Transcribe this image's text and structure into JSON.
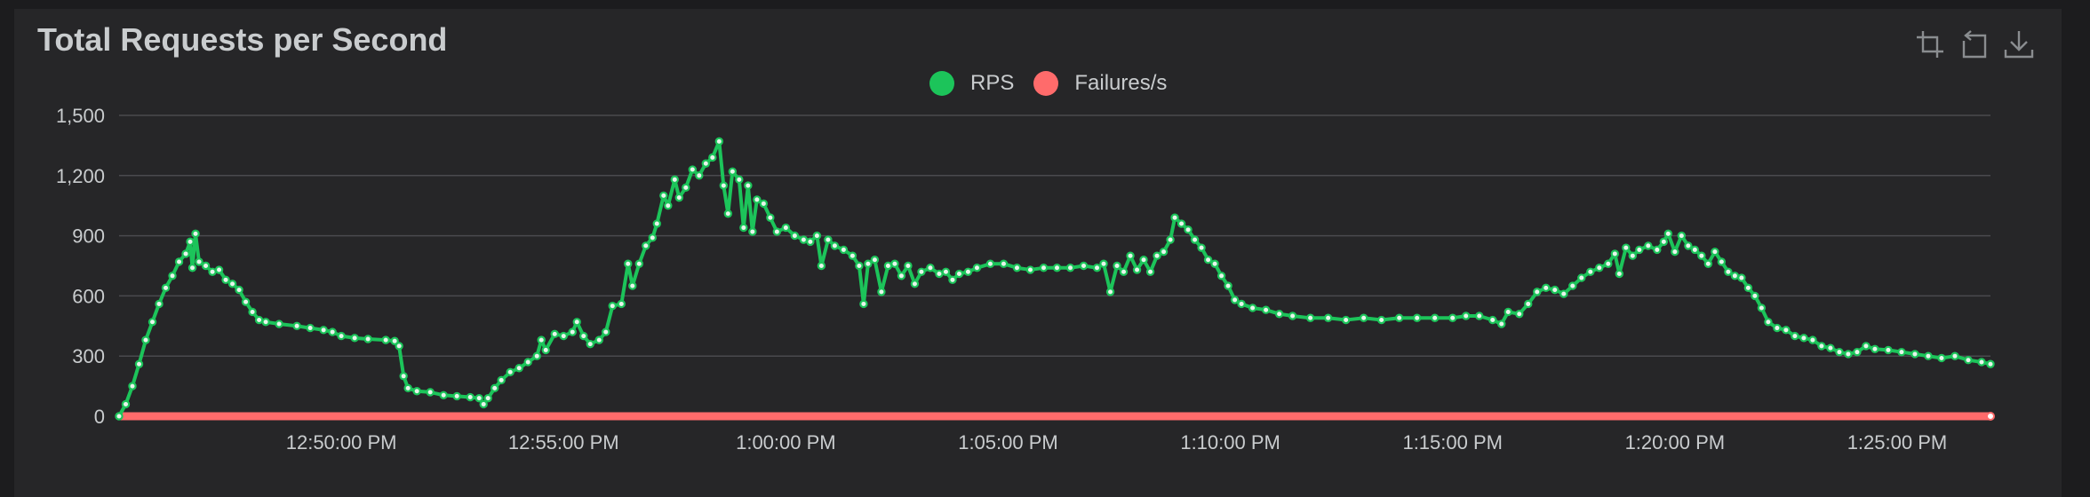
{
  "chart_data": {
    "type": "line",
    "title": "Total Requests per Second",
    "xlabel": "",
    "ylabel": "",
    "ylim": [
      0,
      1500
    ],
    "y_ticks": [
      "0",
      "300",
      "600",
      "900",
      "1,200",
      "1,500"
    ],
    "y_tick_values": [
      0,
      300,
      600,
      900,
      1200,
      1500
    ],
    "x_ticks": [
      "12:50:00 PM",
      "12:55:00 PM",
      "1:00:00 PM",
      "1:05:00 PM",
      "1:10:00 PM",
      "1:15:00 PM",
      "1:20:00 PM",
      "1:25:00 PM"
    ],
    "x_tick_minutes": [
      5,
      10,
      15,
      20,
      25,
      30,
      35,
      40
    ],
    "x_range_minutes": [
      0,
      42.1
    ],
    "grid": true,
    "legend_position": "top-center",
    "series": [
      {
        "name": "RPS",
        "color": "#1cc45a",
        "points": [
          [
            0,
            0
          ],
          [
            0.15,
            60
          ],
          [
            0.3,
            150
          ],
          [
            0.45,
            260
          ],
          [
            0.6,
            380
          ],
          [
            0.75,
            470
          ],
          [
            0.9,
            560
          ],
          [
            1.05,
            640
          ],
          [
            1.2,
            700
          ],
          [
            1.35,
            770
          ],
          [
            1.5,
            810
          ],
          [
            1.6,
            870
          ],
          [
            1.65,
            740
          ],
          [
            1.72,
            910
          ],
          [
            1.8,
            770
          ],
          [
            1.95,
            750
          ],
          [
            2.1,
            720
          ],
          [
            2.25,
            730
          ],
          [
            2.4,
            680
          ],
          [
            2.55,
            660
          ],
          [
            2.7,
            630
          ],
          [
            2.85,
            570
          ],
          [
            3.0,
            520
          ],
          [
            3.15,
            480
          ],
          [
            3.3,
            470
          ],
          [
            3.6,
            460
          ],
          [
            4.0,
            450
          ],
          [
            4.3,
            440
          ],
          [
            4.6,
            430
          ],
          [
            4.8,
            420
          ],
          [
            5.0,
            400
          ],
          [
            5.3,
            390
          ],
          [
            5.6,
            385
          ],
          [
            6.0,
            380
          ],
          [
            6.2,
            375
          ],
          [
            6.3,
            350
          ],
          [
            6.4,
            200
          ],
          [
            6.5,
            140
          ],
          [
            6.7,
            125
          ],
          [
            7.0,
            120
          ],
          [
            7.3,
            105
          ],
          [
            7.6,
            100
          ],
          [
            7.9,
            95
          ],
          [
            8.1,
            90
          ],
          [
            8.2,
            60
          ],
          [
            8.3,
            90
          ],
          [
            8.45,
            140
          ],
          [
            8.6,
            180
          ],
          [
            8.8,
            220
          ],
          [
            9.0,
            240
          ],
          [
            9.2,
            270
          ],
          [
            9.4,
            300
          ],
          [
            9.5,
            380
          ],
          [
            9.6,
            330
          ],
          [
            9.8,
            410
          ],
          [
            10.0,
            400
          ],
          [
            10.2,
            420
          ],
          [
            10.3,
            470
          ],
          [
            10.45,
            400
          ],
          [
            10.6,
            360
          ],
          [
            10.8,
            380
          ],
          [
            10.95,
            420
          ],
          [
            11.1,
            550
          ],
          [
            11.3,
            560
          ],
          [
            11.45,
            760
          ],
          [
            11.55,
            650
          ],
          [
            11.7,
            760
          ],
          [
            11.85,
            850
          ],
          [
            12.0,
            890
          ],
          [
            12.1,
            960
          ],
          [
            12.25,
            1100
          ],
          [
            12.35,
            1050
          ],
          [
            12.5,
            1180
          ],
          [
            12.6,
            1090
          ],
          [
            12.75,
            1140
          ],
          [
            12.9,
            1230
          ],
          [
            13.05,
            1200
          ],
          [
            13.2,
            1260
          ],
          [
            13.35,
            1290
          ],
          [
            13.5,
            1370
          ],
          [
            13.6,
            1150
          ],
          [
            13.7,
            1010
          ],
          [
            13.8,
            1220
          ],
          [
            13.95,
            1180
          ],
          [
            14.05,
            940
          ],
          [
            14.15,
            1150
          ],
          [
            14.25,
            920
          ],
          [
            14.35,
            1080
          ],
          [
            14.5,
            1060
          ],
          [
            14.65,
            990
          ],
          [
            14.8,
            920
          ],
          [
            15.0,
            940
          ],
          [
            15.2,
            900
          ],
          [
            15.4,
            880
          ],
          [
            15.55,
            870
          ],
          [
            15.7,
            900
          ],
          [
            15.8,
            750
          ],
          [
            15.95,
            880
          ],
          [
            16.1,
            850
          ],
          [
            16.3,
            830
          ],
          [
            16.5,
            800
          ],
          [
            16.65,
            750
          ],
          [
            16.75,
            560
          ],
          [
            16.85,
            760
          ],
          [
            17.0,
            780
          ],
          [
            17.15,
            620
          ],
          [
            17.3,
            750
          ],
          [
            17.45,
            760
          ],
          [
            17.6,
            700
          ],
          [
            17.75,
            750
          ],
          [
            17.9,
            660
          ],
          [
            18.05,
            720
          ],
          [
            18.25,
            740
          ],
          [
            18.45,
            710
          ],
          [
            18.6,
            720
          ],
          [
            18.75,
            680
          ],
          [
            18.9,
            710
          ],
          [
            19.1,
            720
          ],
          [
            19.3,
            740
          ],
          [
            19.6,
            760
          ],
          [
            19.9,
            760
          ],
          [
            20.2,
            740
          ],
          [
            20.5,
            730
          ],
          [
            20.8,
            740
          ],
          [
            21.1,
            740
          ],
          [
            21.4,
            740
          ],
          [
            21.7,
            750
          ],
          [
            22.0,
            740
          ],
          [
            22.15,
            760
          ],
          [
            22.3,
            620
          ],
          [
            22.45,
            750
          ],
          [
            22.6,
            720
          ],
          [
            22.75,
            800
          ],
          [
            22.9,
            730
          ],
          [
            23.05,
            780
          ],
          [
            23.2,
            720
          ],
          [
            23.35,
            800
          ],
          [
            23.5,
            820
          ],
          [
            23.65,
            880
          ],
          [
            23.75,
            990
          ],
          [
            23.9,
            960
          ],
          [
            24.05,
            930
          ],
          [
            24.2,
            880
          ],
          [
            24.35,
            840
          ],
          [
            24.5,
            780
          ],
          [
            24.65,
            760
          ],
          [
            24.8,
            700
          ],
          [
            24.95,
            650
          ],
          [
            25.1,
            580
          ],
          [
            25.25,
            560
          ],
          [
            25.5,
            540
          ],
          [
            25.8,
            530
          ],
          [
            26.1,
            510
          ],
          [
            26.4,
            500
          ],
          [
            26.8,
            490
          ],
          [
            27.2,
            490
          ],
          [
            27.6,
            480
          ],
          [
            28.0,
            490
          ],
          [
            28.4,
            480
          ],
          [
            28.8,
            490
          ],
          [
            29.2,
            490
          ],
          [
            29.6,
            490
          ],
          [
            30.0,
            490
          ],
          [
            30.3,
            500
          ],
          [
            30.6,
            500
          ],
          [
            30.9,
            480
          ],
          [
            31.1,
            460
          ],
          [
            31.25,
            520
          ],
          [
            31.5,
            510
          ],
          [
            31.7,
            560
          ],
          [
            31.9,
            620
          ],
          [
            32.1,
            640
          ],
          [
            32.3,
            630
          ],
          [
            32.5,
            610
          ],
          [
            32.7,
            650
          ],
          [
            32.9,
            690
          ],
          [
            33.1,
            720
          ],
          [
            33.3,
            740
          ],
          [
            33.5,
            760
          ],
          [
            33.65,
            810
          ],
          [
            33.75,
            710
          ],
          [
            33.9,
            840
          ],
          [
            34.05,
            800
          ],
          [
            34.2,
            830
          ],
          [
            34.4,
            850
          ],
          [
            34.6,
            830
          ],
          [
            34.75,
            870
          ],
          [
            34.85,
            910
          ],
          [
            35.0,
            820
          ],
          [
            35.15,
            900
          ],
          [
            35.3,
            850
          ],
          [
            35.45,
            830
          ],
          [
            35.6,
            800
          ],
          [
            35.75,
            760
          ],
          [
            35.9,
            820
          ],
          [
            36.05,
            770
          ],
          [
            36.2,
            720
          ],
          [
            36.35,
            700
          ],
          [
            36.5,
            690
          ],
          [
            36.65,
            640
          ],
          [
            36.8,
            600
          ],
          [
            36.95,
            540
          ],
          [
            37.1,
            470
          ],
          [
            37.3,
            440
          ],
          [
            37.5,
            430
          ],
          [
            37.7,
            400
          ],
          [
            37.9,
            390
          ],
          [
            38.1,
            380
          ],
          [
            38.3,
            350
          ],
          [
            38.5,
            340
          ],
          [
            38.7,
            320
          ],
          [
            38.9,
            310
          ],
          [
            39.1,
            320
          ],
          [
            39.3,
            350
          ],
          [
            39.5,
            335
          ],
          [
            39.8,
            330
          ],
          [
            40.1,
            320
          ],
          [
            40.4,
            310
          ],
          [
            40.7,
            300
          ],
          [
            41.0,
            290
          ],
          [
            41.3,
            300
          ],
          [
            41.6,
            280
          ],
          [
            41.9,
            270
          ],
          [
            42.1,
            260
          ]
        ]
      },
      {
        "name": "Failures/s",
        "color": "#ff6b6b",
        "points": [
          [
            0,
            0
          ],
          [
            42.1,
            0
          ]
        ]
      }
    ]
  },
  "toolbar": {
    "icons": [
      "data-zoom-icon",
      "restore-icon",
      "save-image-icon"
    ]
  }
}
